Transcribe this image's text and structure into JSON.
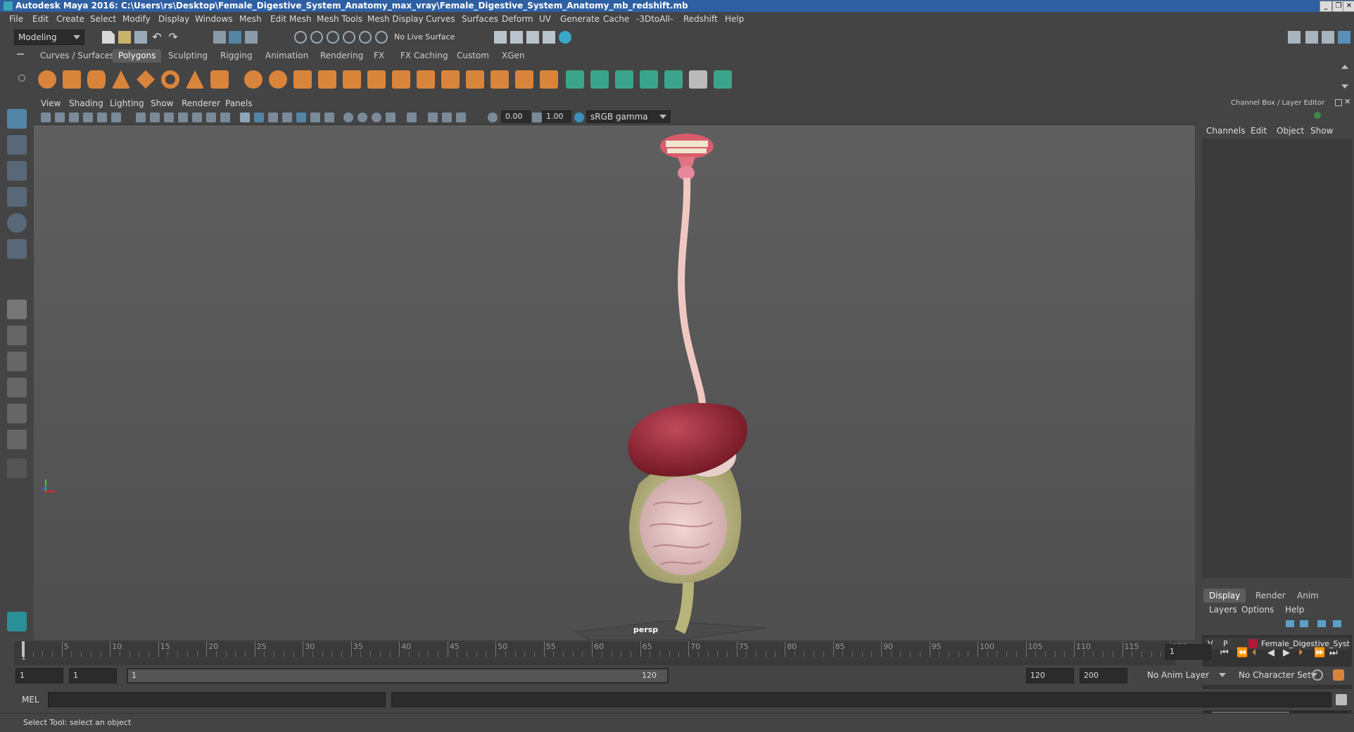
{
  "window": {
    "title": "Autodesk Maya 2016: C:\\Users\\rs\\Desktop\\Female_Digestive_System_Anatomy_max_vray\\Female_Digestive_System_Anatomy_mb_redshift.mb"
  },
  "menubar": [
    "File",
    "Edit",
    "Create",
    "Select",
    "Modify",
    "Display",
    "Windows",
    "Mesh",
    "Edit Mesh",
    "Mesh Tools",
    "Mesh Display",
    "Curves",
    "Surfaces",
    "Deform",
    "UV",
    "Generate",
    "Cache",
    "-3DtoAll-",
    "Redshift",
    "Help"
  ],
  "status_line": {
    "mode": "Modeling",
    "live_surface": "No Live Surface"
  },
  "shelf_tabs": [
    "Curves / Surfaces",
    "Polygons",
    "Sculpting",
    "Rigging",
    "Animation",
    "Rendering",
    "FX",
    "FX Caching",
    "Custom",
    "XGen"
  ],
  "shelf_active_tab": "Polygons",
  "panel_menu": [
    "View",
    "Shading",
    "Lighting",
    "Show",
    "Renderer",
    "Panels"
  ],
  "panel_toolbar": {
    "exposure": "0.00",
    "gamma": "1.00",
    "color_space": "sRGB gamma"
  },
  "viewport": {
    "camera": "persp"
  },
  "channel_box": {
    "title": "Channel Box / Layer Editor",
    "menus": [
      "Channels",
      "Edit",
      "Object",
      "Show"
    ],
    "layer_tabs": [
      "Display",
      "Render",
      "Anim"
    ],
    "layer_active_tab": "Display",
    "layer_menus": [
      "Layers",
      "Options",
      "Help"
    ],
    "layers": [
      {
        "v": "V",
        "p": "P",
        "color": "#b01a3a",
        "name": "Female_Digestive_Syst"
      }
    ]
  },
  "time_slider": {
    "ticks": [
      "5",
      "10",
      "15",
      "20",
      "25",
      "30",
      "35",
      "40",
      "45",
      "50",
      "55",
      "60",
      "65",
      "70",
      "75",
      "80",
      "85",
      "90",
      "95",
      "100",
      "105",
      "110",
      "115",
      "120"
    ],
    "start_label": "1",
    "current_frame": "1"
  },
  "range_slider": {
    "start_field": "1",
    "playback_start": "1",
    "range_start_label": "1",
    "range_end_label": "120",
    "playback_end": "120",
    "end_field": "200",
    "anim_layer": "No Anim Layer",
    "character_set": "No Character Set"
  },
  "command_line": {
    "label": "MEL"
  },
  "help_line": "Select Tool: select an object",
  "colors": {
    "accent": "#5285a6",
    "titlebar": "#2e5fa3",
    "shelf_orange": "#d9843b",
    "shelf_green": "#3aa58a"
  }
}
